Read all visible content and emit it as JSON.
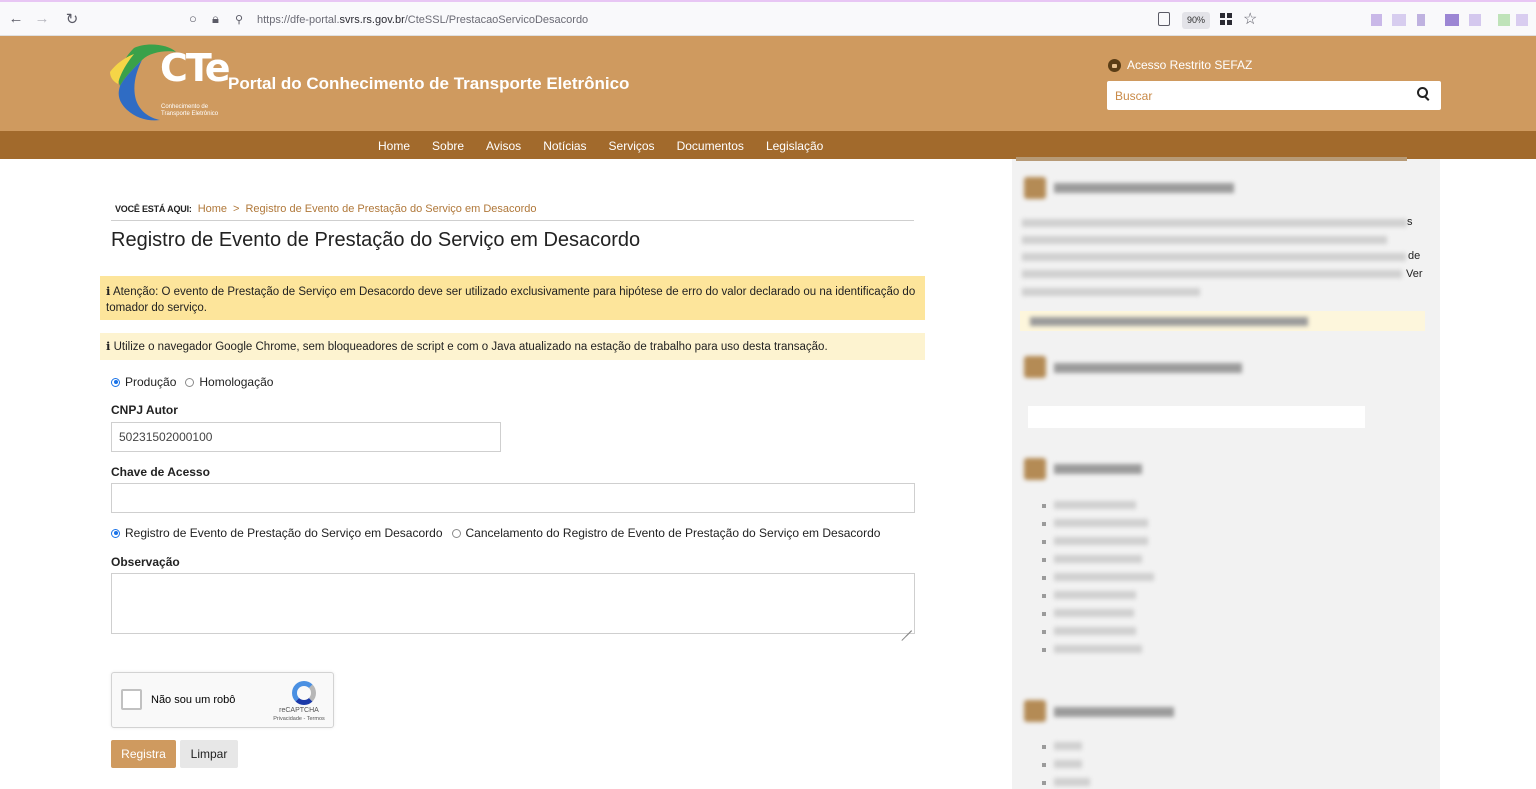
{
  "browser": {
    "url_prefix": "https://dfe-portal.",
    "url_domain": "svrs.rs.gov.br",
    "url_path": "/CteSSL/PrestacaoServicoDesacordo",
    "zoom": "90%"
  },
  "header": {
    "logo_text": "CTe",
    "logo_sub_1": "Conhecimento de",
    "logo_sub_2": "Transporte Eletrônico",
    "portal_title": "Portal do Conhecimento de Transporte Eletrônico",
    "restricted_access": "Acesso Restrito SEFAZ",
    "search_placeholder": "Buscar"
  },
  "nav": {
    "items": [
      "Home",
      "Sobre",
      "Avisos",
      "Notícias",
      "Serviços",
      "Documentos",
      "Legislação"
    ]
  },
  "breadcrumb": {
    "label": "VOCÊ ESTÁ AQUI:",
    "home": "Home",
    "separator": ">",
    "current": "Registro de Evento de Prestação do Serviço em Desacordo"
  },
  "page_title": "Registro de Evento de Prestação do Serviço em Desacordo",
  "alerts": {
    "warning": "Atenção: O evento de Prestação de Serviço em Desacordo deve ser utilizado exclusivamente para hipótese de erro do valor declarado ou na identificação do tomador do serviço.",
    "info": "Utilize o navegador Google Chrome, sem bloqueadores de script e com o Java atualizado na estação de trabalho para uso desta transação."
  },
  "environment": {
    "options": [
      "Produção",
      "Homologação"
    ],
    "selected": "Produção"
  },
  "form": {
    "cnpj_label": "CNPJ Autor",
    "cnpj_value": "50231502000100",
    "chave_label": "Chave de Acesso",
    "chave_value": "",
    "event_options": [
      "Registro de Evento de Prestação do Serviço em Desacordo",
      "Cancelamento do Registro de Evento de Prestação do Serviço em Desacordo"
    ],
    "event_selected": "Registro de Evento de Prestação do Serviço em Desacordo",
    "obs_label": "Observação",
    "obs_value": ""
  },
  "captcha": {
    "label": "Não sou um robô",
    "brand": "reCAPTCHA",
    "links": "Privacidade - Termos"
  },
  "buttons": {
    "submit": "Registra",
    "clear": "Limpar"
  },
  "sidebar": {
    "visible_fragments": [
      "s",
      "de",
      "Ver"
    ]
  },
  "colors": {
    "header_bg": "#cf9a5f",
    "nav_bg": "#a26a2c",
    "warning_bg": "#fde59b",
    "info_bg": "#fdf3d0",
    "link": "#b0783a"
  }
}
